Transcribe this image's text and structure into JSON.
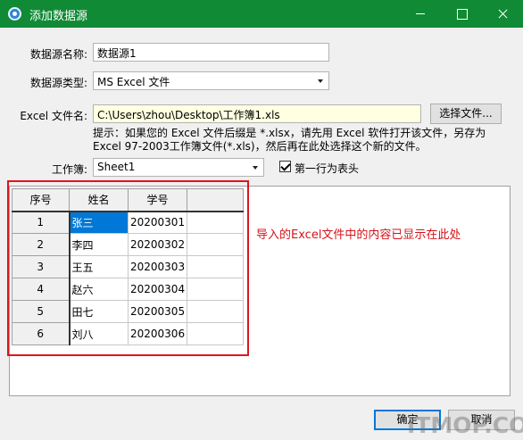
{
  "window": {
    "title": "添加数据源",
    "icons": {
      "app": "app-icon",
      "minimize": "minimize-icon",
      "maximize": "maximize-icon",
      "close": "close-icon"
    },
    "colors": {
      "titlebar": "#118a35",
      "selection": "#0078d7",
      "annotation": "#e0141e"
    }
  },
  "form": {
    "datasource_name_label": "数据源名称:",
    "datasource_name_value": "数据源1",
    "datasource_type_label": "数据源类型:",
    "datasource_type_value": "MS Excel 文件",
    "excel_file_label": "Excel 文件名:",
    "excel_file_value": "C:\\Users\\zhou\\Desktop\\工作簿1.xls",
    "choose_file_button": "选择文件...",
    "hint": "提示：如果您的 Excel 文件后缀是 *.xlsx，请先用 Excel 软件打开该文件，另存为 Excel 97-2003工作簿文件(*.xls)，然后再在此处选择这个新的文件。",
    "workbook_label": "工作簿:",
    "workbook_value": "Sheet1",
    "first_row_header_label": "第一行为表头",
    "first_row_header_checked": true
  },
  "grid": {
    "headers": [
      "序号",
      "姓名",
      "学号",
      ""
    ],
    "rows": [
      {
        "index": "1",
        "name": "张三",
        "id": "20200301"
      },
      {
        "index": "2",
        "name": "李四",
        "id": "20200302"
      },
      {
        "index": "3",
        "name": "王五",
        "id": "20200303"
      },
      {
        "index": "4",
        "name": "赵六",
        "id": "20200304"
      },
      {
        "index": "5",
        "name": "田七",
        "id": "20200305"
      },
      {
        "index": "6",
        "name": "刘八",
        "id": "20200306"
      }
    ],
    "selected_cell": "张三"
  },
  "annotation": "导入的Excel文件中的内容已显示在此处",
  "buttons": {
    "ok": "确定",
    "cancel": "取消"
  },
  "watermark": "ITMOP.COM"
}
